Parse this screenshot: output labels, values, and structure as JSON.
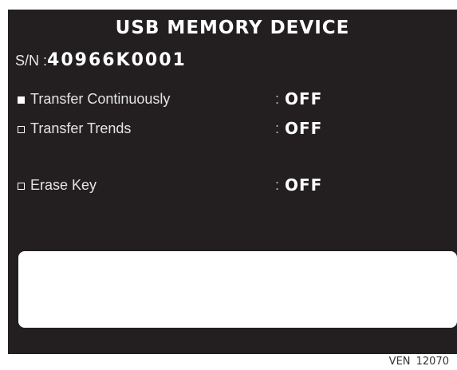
{
  "screen": {
    "title": "USB MEMORY DEVICE",
    "serial": {
      "label": "S/N :",
      "value": "40966K0001"
    },
    "options": [
      {
        "label": "Transfer Continuously",
        "separator": ":",
        "value": "OFF",
        "selected": true
      },
      {
        "label": "Transfer Trends",
        "separator": ":",
        "value": "OFF",
        "selected": false
      },
      {
        "label": "Erase Key",
        "separator": ":",
        "value": "OFF",
        "selected": false
      }
    ],
    "message": ""
  },
  "footer": {
    "figure_id": "VEN 12070"
  },
  "colors": {
    "screen_bg": "#231f20",
    "text": "#ffffff",
    "message_box": "#ffffff"
  }
}
